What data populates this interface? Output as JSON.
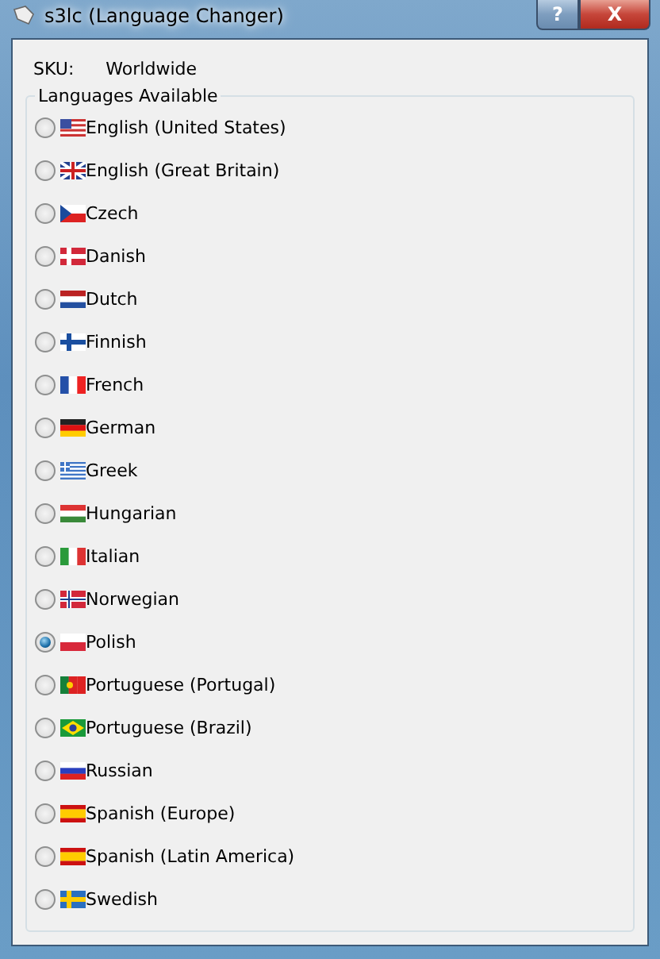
{
  "window": {
    "title": "s3lc (Language Changer)",
    "buttons": [
      "?",
      "X"
    ]
  },
  "sku": {
    "label": "SKU:",
    "value": "Worldwide"
  },
  "group": {
    "title": "Languages Available",
    "languages": [
      {
        "label": "English (United States)",
        "selected": false
      },
      {
        "label": "English (Great Britain)",
        "selected": false
      },
      {
        "label": "Czech",
        "selected": false
      },
      {
        "label": "Danish",
        "selected": false
      },
      {
        "label": "Dutch",
        "selected": false
      },
      {
        "label": "Finnish",
        "selected": false
      },
      {
        "label": "French",
        "selected": false
      },
      {
        "label": "German",
        "selected": false
      },
      {
        "label": "Greek",
        "selected": false
      },
      {
        "label": "Hungarian",
        "selected": false
      },
      {
        "label": "Italian",
        "selected": false
      },
      {
        "label": "Norwegian",
        "selected": false
      },
      {
        "label": "Polish",
        "selected": true
      },
      {
        "label": "Portuguese (Portugal)",
        "selected": false
      },
      {
        "label": "Portuguese (Brazil)",
        "selected": false
      },
      {
        "label": "Russian",
        "selected": false
      },
      {
        "label": "Spanish (Europe)",
        "selected": false
      },
      {
        "label": "Spanish (Latin America)",
        "selected": false
      },
      {
        "label": "Swedish",
        "selected": false
      }
    ]
  }
}
